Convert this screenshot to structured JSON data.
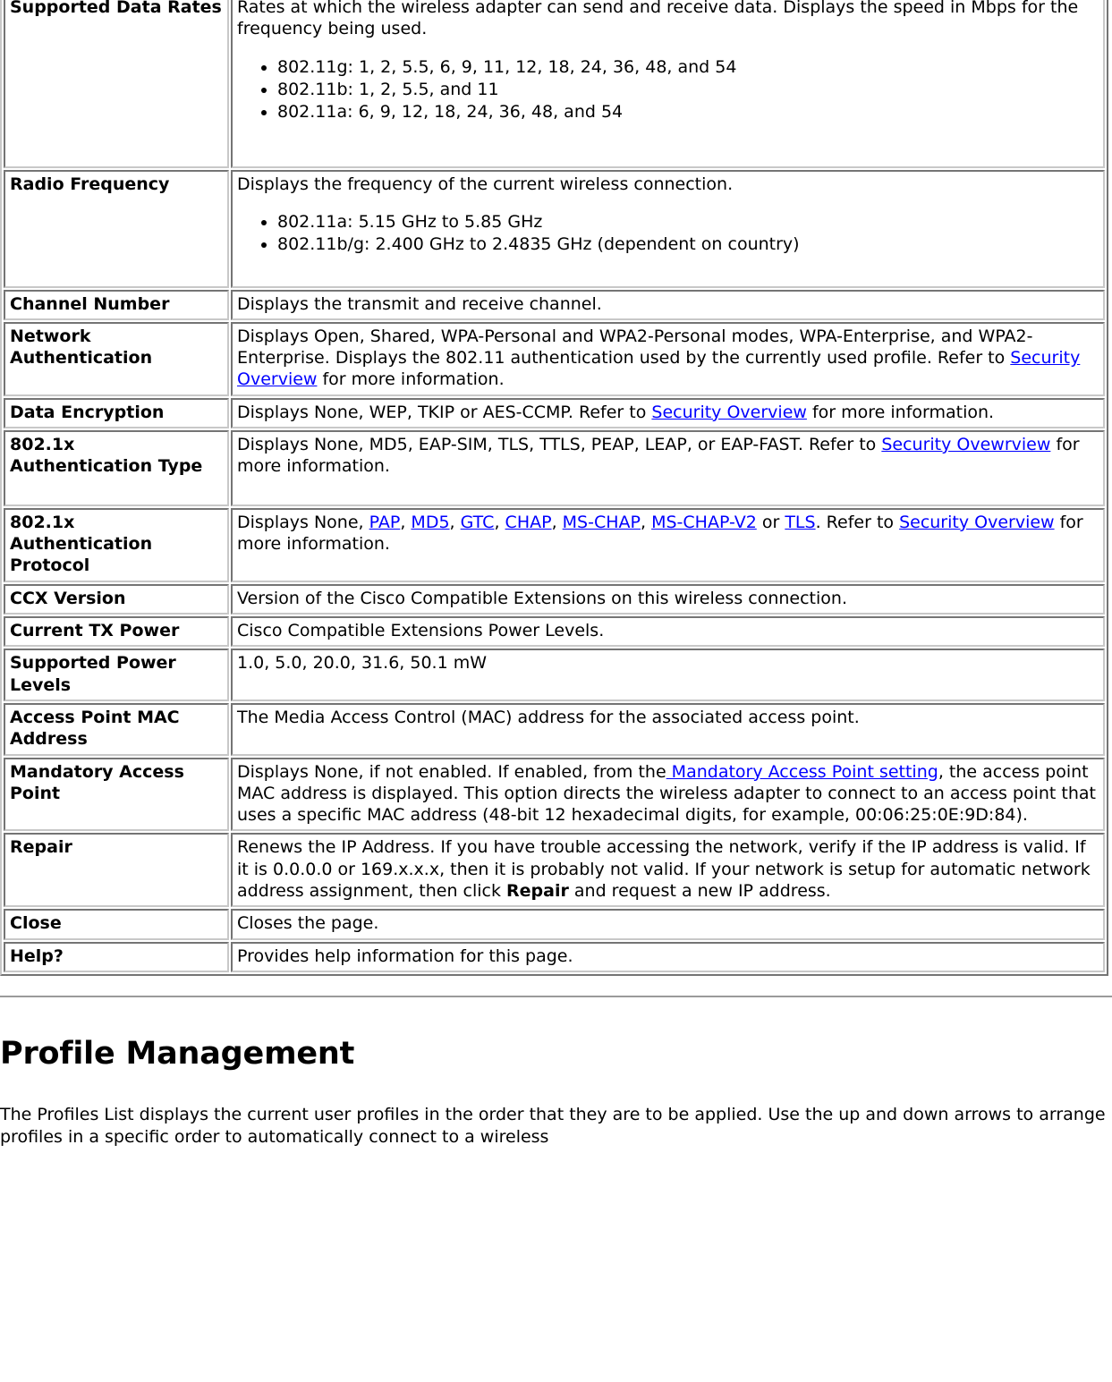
{
  "table": {
    "rows": [
      {
        "label": "Supported Data Rates",
        "intro": "Rates at which the wireless adapter can send and receive data. Displays the speed in Mbps for the frequency being used.",
        "bullets": [
          "802.11g: 1, 2, 5.5, 6, 9, 11, 12, 18, 24, 36, 48, and 54",
          "802.11b: 1, 2, 5.5, and 11",
          "802.11a: 6, 9, 12, 18, 24, 36, 48, and 54"
        ]
      },
      {
        "label": "Radio Frequency",
        "intro": "Displays the frequency of the current wireless connection.",
        "bullets": [
          "802.11a: 5.15 GHz to 5.85 GHz",
          "802.11b/g: 2.400 GHz to 2.4835 GHz (dependent on country)"
        ]
      },
      {
        "label": "Channel Number",
        "text": "Displays the transmit and receive channel."
      },
      {
        "label": "Network Authentication",
        "seg_a": "Displays Open, Shared, WPA-Personal and WPA2-Personal modes, WPA-Enterprise, and WPA2-Enterprise. Displays the 802.11 authentication used by the currently used profile. Refer to ",
        "link_1": "Security Overview",
        "seg_b": " for more information."
      },
      {
        "label": "Data Encryption",
        "seg_a": "Displays None, WEP, TKIP or AES-CCMP. Refer to ",
        "link_1": "Security Overview",
        "seg_b": " for more information."
      },
      {
        "label": "802.1x Authentication Type",
        "seg_a": "Displays None, MD5, EAP-SIM, TLS, TTLS, PEAP, LEAP, or EAP-FAST. Refer to ",
        "link_1": "Security Ovewrview",
        "seg_b": " for more information."
      },
      {
        "label": "802.1x Authentication Protocol",
        "seg_a": "Displays None, ",
        "link_pap": "PAP",
        "sep_1": ", ",
        "link_md5": "MD5",
        "sep_2": ", ",
        "link_gtc": "GTC",
        "sep_3": ", ",
        "link_chap": "CHAP",
        "sep_4": ", ",
        "link_mschap": "MS-CHAP",
        "sep_5": ", ",
        "link_mschapv2": "MS-CHAP-V2",
        "sep_6": " or ",
        "link_tls": "TLS",
        "sep_7": ". Refer to ",
        "link_so": "Security Overview",
        "seg_b": " for more information."
      },
      {
        "label": "CCX Version",
        "text": "Version of the Cisco Compatible Extensions on this wireless connection."
      },
      {
        "label": "Current TX Power",
        "text": "Cisco Compatible Extensions Power Levels."
      },
      {
        "label": "Supported Power Levels",
        "text": "1.0, 5.0, 20.0, 31.6, 50.1 mW"
      },
      {
        "label": "Access Point MAC Address",
        "text": "The Media Access Control (MAC) address for the associated access point."
      },
      {
        "label": "Mandatory Access Point",
        "seg_a": "Displays None, if not enabled. If enabled, from the",
        "link_1": " Mandatory Access Point setting",
        "seg_b": ", the access point MAC address is displayed. This option directs the wireless adapter to connect to an access point that uses a specific MAC address (48-bit 12 hexadecimal digits, for example, 00:06:25:0E:9D:84)."
      },
      {
        "label": "Repair",
        "seg_a": "Renews the IP Address. If you have trouble accessing the network, verify if the IP address is valid. If it is 0.0.0.0 or 169.x.x.x, then it is probably not valid. If your network is setup for automatic network address assignment, then click ",
        "bold_1": "Repair",
        "seg_b": " and request a new IP address."
      },
      {
        "label": "Close",
        "text": "Closes the page."
      },
      {
        "label": "Help?",
        "text": "Provides help information for this page."
      }
    ]
  },
  "section": {
    "heading": "Profile Management",
    "paragraph": "The Profiles List displays the current user profiles in the order that they are to be applied. Use the up and down arrows to arrange profiles in a specific order to automatically connect to a wireless"
  }
}
